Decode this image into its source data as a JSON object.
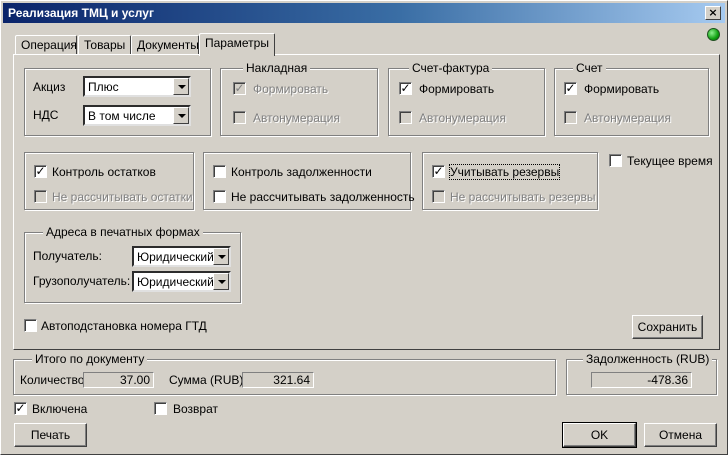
{
  "window": {
    "title": "Реализация ТМЦ и услуг",
    "close_glyph": "×"
  },
  "tabs": [
    {
      "label": "Операция"
    },
    {
      "label": "Товары"
    },
    {
      "label": "Документы"
    },
    {
      "label": "Параметры",
      "active": true
    }
  ],
  "taxes": {
    "akciz_label": "Акциз",
    "akciz_value": "Плюс",
    "nds_label": "НДС",
    "nds_value": "В том числе"
  },
  "nakladnaya": {
    "title": "Накладная",
    "form_label": "Формировать",
    "form_checked": true,
    "form_enabled": false,
    "auto_label": "Автонумерация",
    "auto_checked": false,
    "auto_enabled": false
  },
  "schet_faktura": {
    "title": "Счет-фактура",
    "form_label": "Формировать",
    "form_checked": true,
    "form_enabled": true,
    "auto_label": "Автонумерация",
    "auto_checked": false,
    "auto_enabled": false
  },
  "schet": {
    "title": "Счет",
    "form_label": "Формировать",
    "form_checked": true,
    "form_enabled": true,
    "auto_label": "Автонумерация",
    "auto_checked": false,
    "auto_enabled": false
  },
  "ostatki": {
    "control_label": "Контроль остатков",
    "control_checked": true,
    "nocalc_label": "Не рассчитывать остатки",
    "nocalc_checked": false
  },
  "zadolzh": {
    "control_label": "Контроль задолженности",
    "control_checked": false,
    "nocalc_label": "Не рассчитывать задолженность",
    "nocalc_checked": false
  },
  "rezervy": {
    "control_label": "Учитывать резервы",
    "control_checked": true,
    "nocalc_label": "Не рассчитывать резервы",
    "nocalc_checked": false
  },
  "current_time": {
    "label": "Текущее время",
    "checked": false
  },
  "addresses": {
    "title": "Адреса в печатных формах",
    "recipient_label": "Получатель:",
    "recipient_value": "Юридический",
    "consignee_label": "Грузополучатель:",
    "consignee_value": "Юридический"
  },
  "gtd": {
    "label": "Автоподстановка номера ГТД",
    "checked": false
  },
  "save_button": "Сохранить",
  "totals": {
    "title": "Итого по документу",
    "qty_label": "Количество",
    "qty_value": "37.00",
    "sum_label": "Сумма (RUB)",
    "sum_value": "321.64"
  },
  "debt": {
    "title": "Задолженность (RUB)",
    "value": "-478.36"
  },
  "included": {
    "label": "Включена",
    "checked": true
  },
  "return": {
    "label": "Возврат",
    "checked": false
  },
  "buttons": {
    "print": "Печать",
    "ok": "OK",
    "cancel": "Отмена"
  }
}
